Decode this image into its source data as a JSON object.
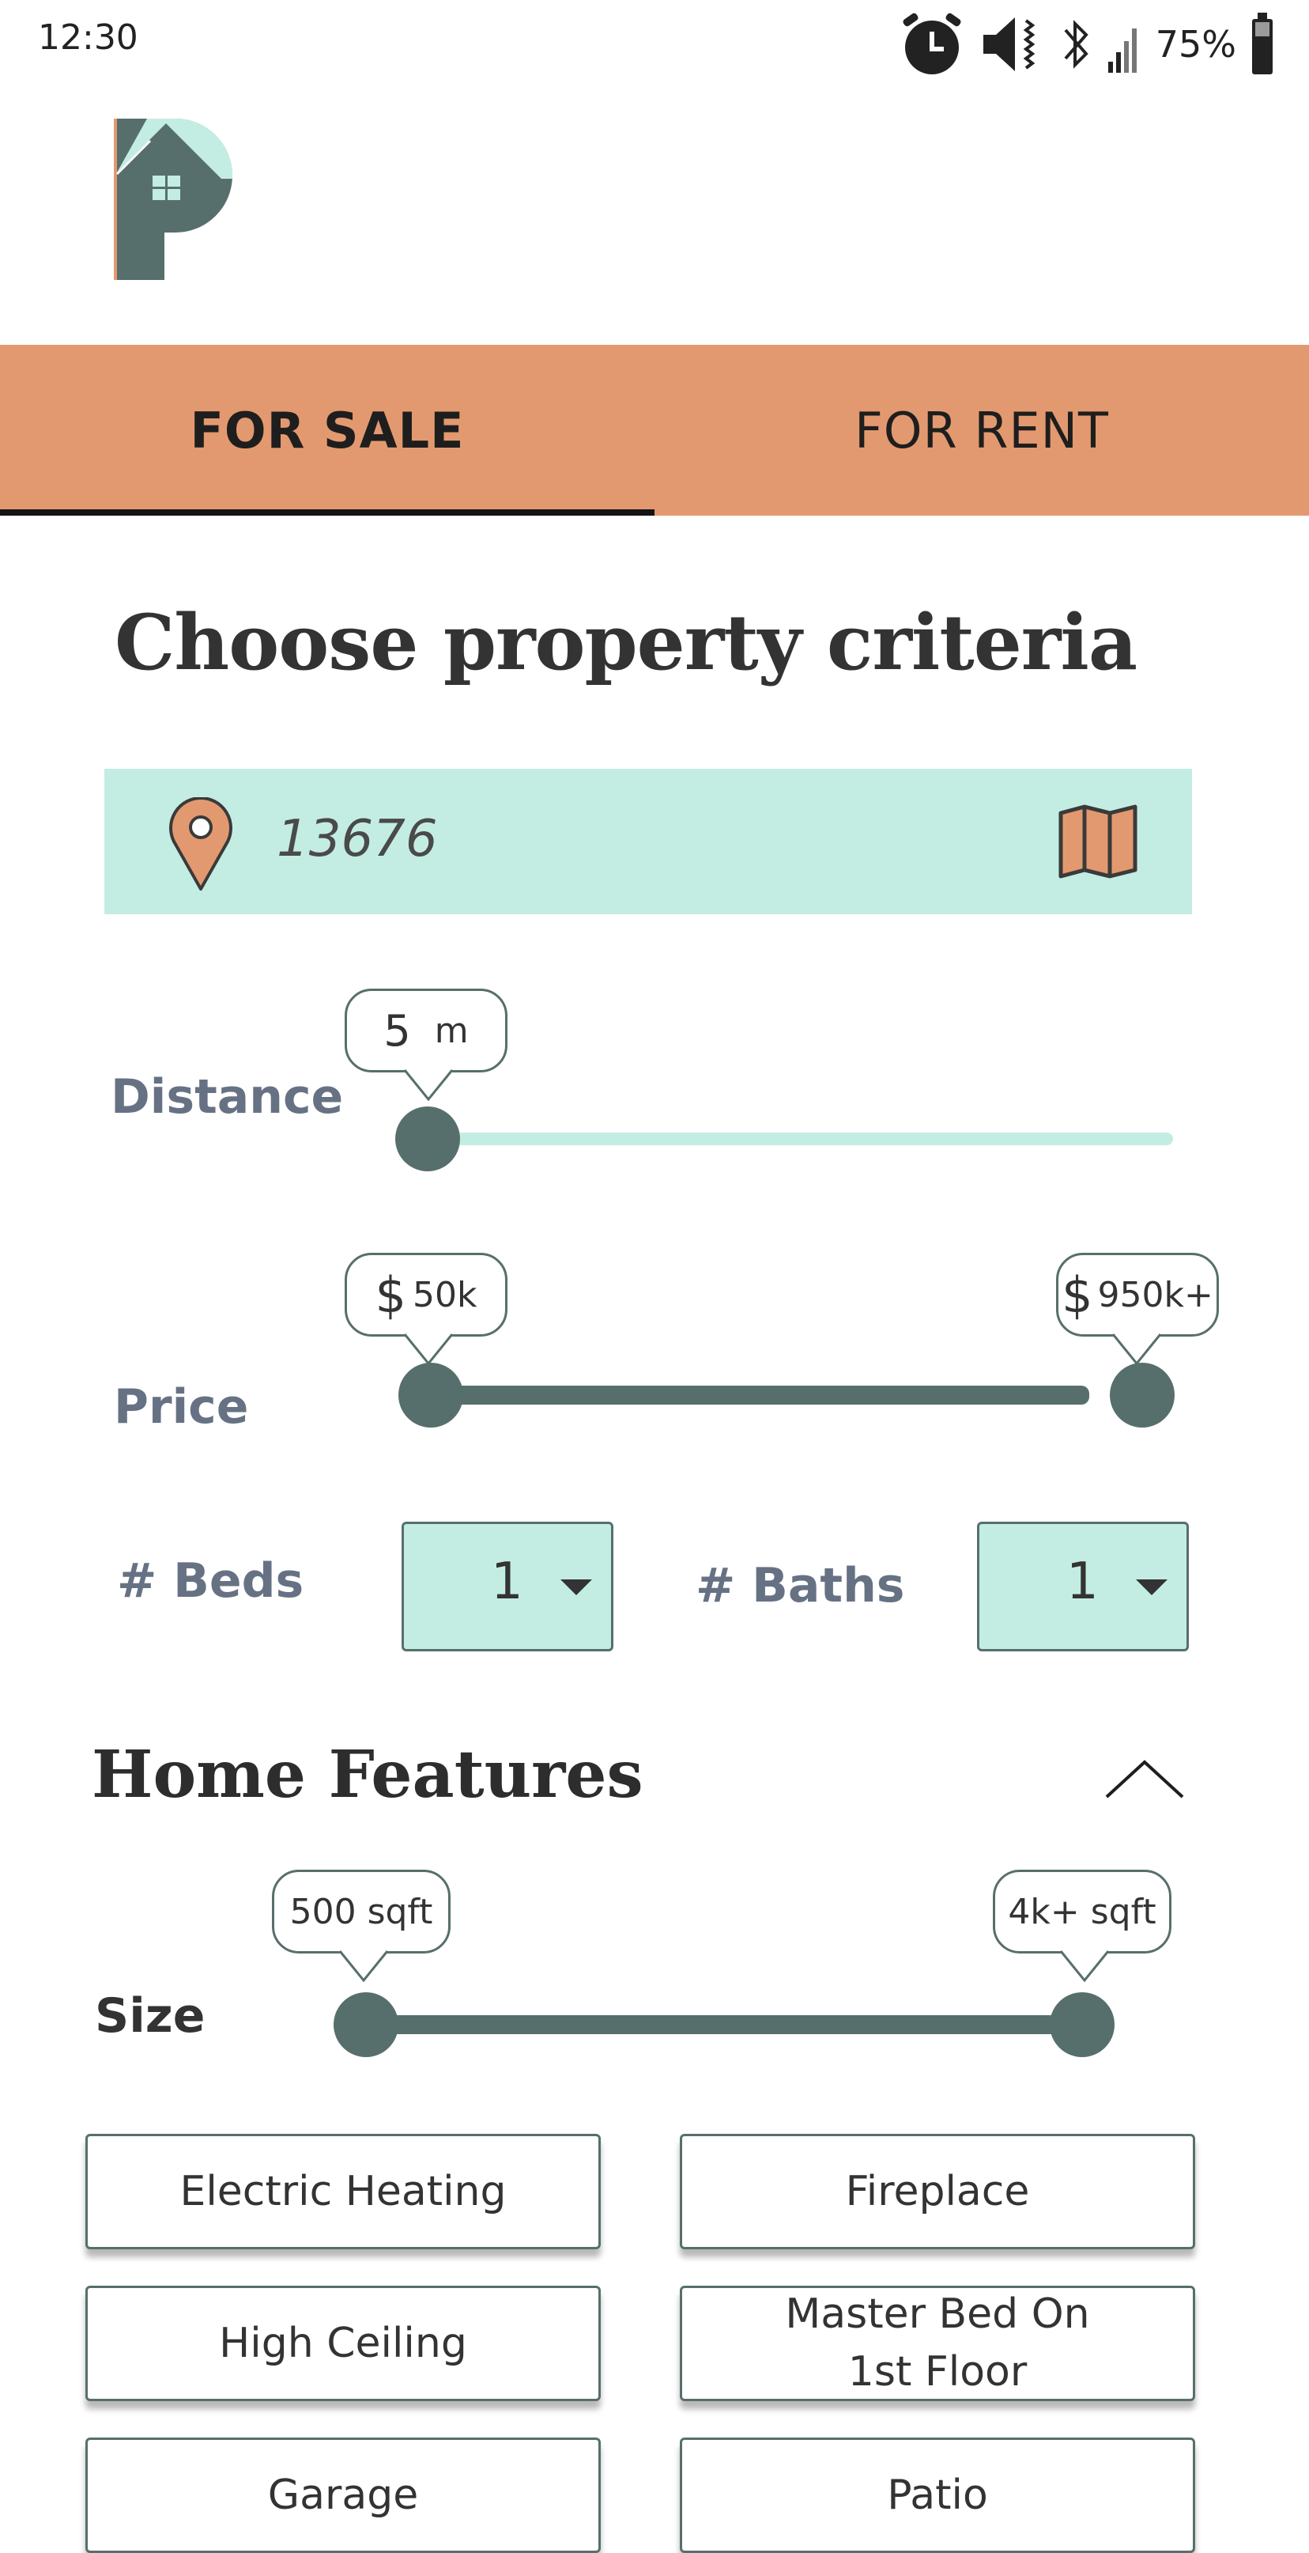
{
  "status_bar": {
    "time": "12:30",
    "battery": "75%",
    "icons": [
      "alarm-icon",
      "volume-vibrate-icon",
      "bluetooth-icon",
      "signal-icon",
      "battery-icon"
    ]
  },
  "logo": {
    "letter": "P"
  },
  "tabs": [
    {
      "label": "FOR SALE",
      "active": true
    },
    {
      "label": "FOR RENT",
      "active": false
    }
  ],
  "page_title": "Choose property criteria",
  "search": {
    "value": "13676",
    "left_icon": "location-pin-icon",
    "right_icon": "map-icon"
  },
  "distance": {
    "label": "Distance",
    "value": "5",
    "unit": "m",
    "fraction": 0.0
  },
  "price": {
    "label": "Price",
    "currency": "$",
    "min": "50k",
    "max": "950k+"
  },
  "beds": {
    "label": "# Beds",
    "value": "1"
  },
  "baths": {
    "label": "# Baths",
    "value": "1"
  },
  "home_features": {
    "title": "Home Features",
    "collapse_icon": "chevron-up-icon",
    "size": {
      "label": "Size",
      "min": "500 sqft",
      "max": "4k+ sqft"
    },
    "features": [
      [
        "Electric Heating"
      ],
      [
        "Fireplace"
      ],
      [
        "High Ceiling"
      ],
      [
        "Master Bed On",
        "1st Floor"
      ],
      [
        "Garage"
      ],
      [
        "Patio"
      ]
    ]
  },
  "colors": {
    "accent_orange": "#e3996f",
    "mint": "#c3ede3",
    "slate": "#576f6c",
    "label_gray": "#667284"
  }
}
